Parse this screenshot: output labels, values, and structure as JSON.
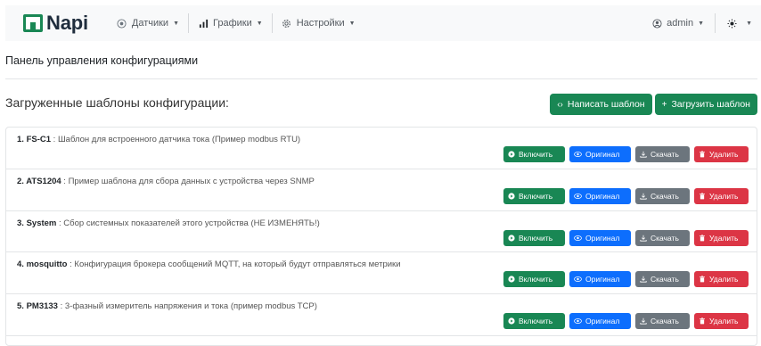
{
  "brand": {
    "name": "Napi"
  },
  "nav": {
    "sensors": "Датчики",
    "charts": "Графики",
    "settings": "Настройки",
    "user": "admin"
  },
  "page": {
    "panel_title": "Панель управления конфигурациями",
    "section_title": "Загруженные шаблоны конфигурации:",
    "write_template": "Написать шаблон",
    "upload_template": "Загрузить шаблон"
  },
  "actions": {
    "enable": "Включить",
    "original": "Оригинал",
    "download": "Скачать",
    "delete": "Удалить"
  },
  "templates": [
    {
      "index": "1.",
      "name": "FS-C1",
      "description": " : Шаблон для встроенного датчика тока (Пример modbus RTU)"
    },
    {
      "index": "2.",
      "name": "ATS1204",
      "description": " : Пример шаблона для сбора данных с устройства через SNMP"
    },
    {
      "index": "3.",
      "name": "System",
      "description": " : Сбор системных показателей этого устройства (НЕ ИЗМЕНЯТЬ!)"
    },
    {
      "index": "4.",
      "name": "mosquitto",
      "description": " : Конфигурация брокера сообщений MQTT, на который будут отправляться метрики"
    },
    {
      "index": "5.",
      "name": "PM3133",
      "description": " : 3-фазный измеритель напряжения и тока (пример modbus TCP)"
    }
  ],
  "colors": {
    "success": "#198754",
    "primary": "#0d6efd",
    "secondary": "#6c757d",
    "danger": "#dc3545",
    "navbar_bg": "#f8f9fa"
  }
}
